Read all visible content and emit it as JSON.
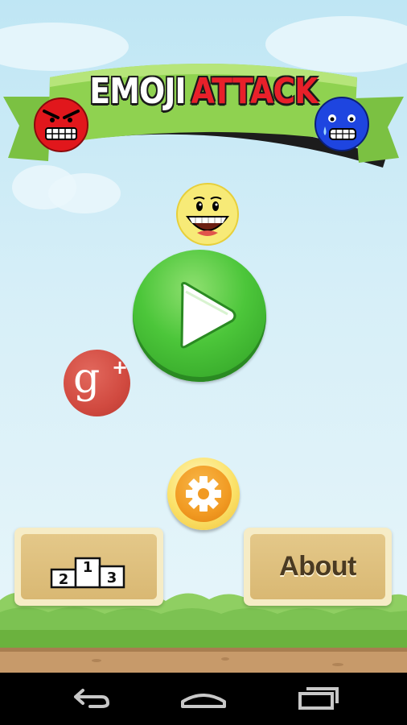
{
  "game": {
    "title_part1": "EMOJI",
    "title_part2": "ATTACK"
  },
  "menu": {
    "play": "play-button",
    "google_plus": {
      "letter": "g",
      "plus": "+"
    },
    "settings": "settings-button",
    "leaderboard": {
      "first": "1",
      "second": "2",
      "third": "3"
    },
    "about_label": "About"
  },
  "navbar": {
    "back": "back-icon",
    "home": "home-icon",
    "recents": "recents-icon"
  },
  "colors": {
    "title_red": "#e8202a",
    "banner_green": "#8fd250",
    "play_green": "#4cc63a",
    "gplus_red": "#d14a40",
    "settings_orange": "#f19a22",
    "panel_tan": "#e4c889"
  }
}
